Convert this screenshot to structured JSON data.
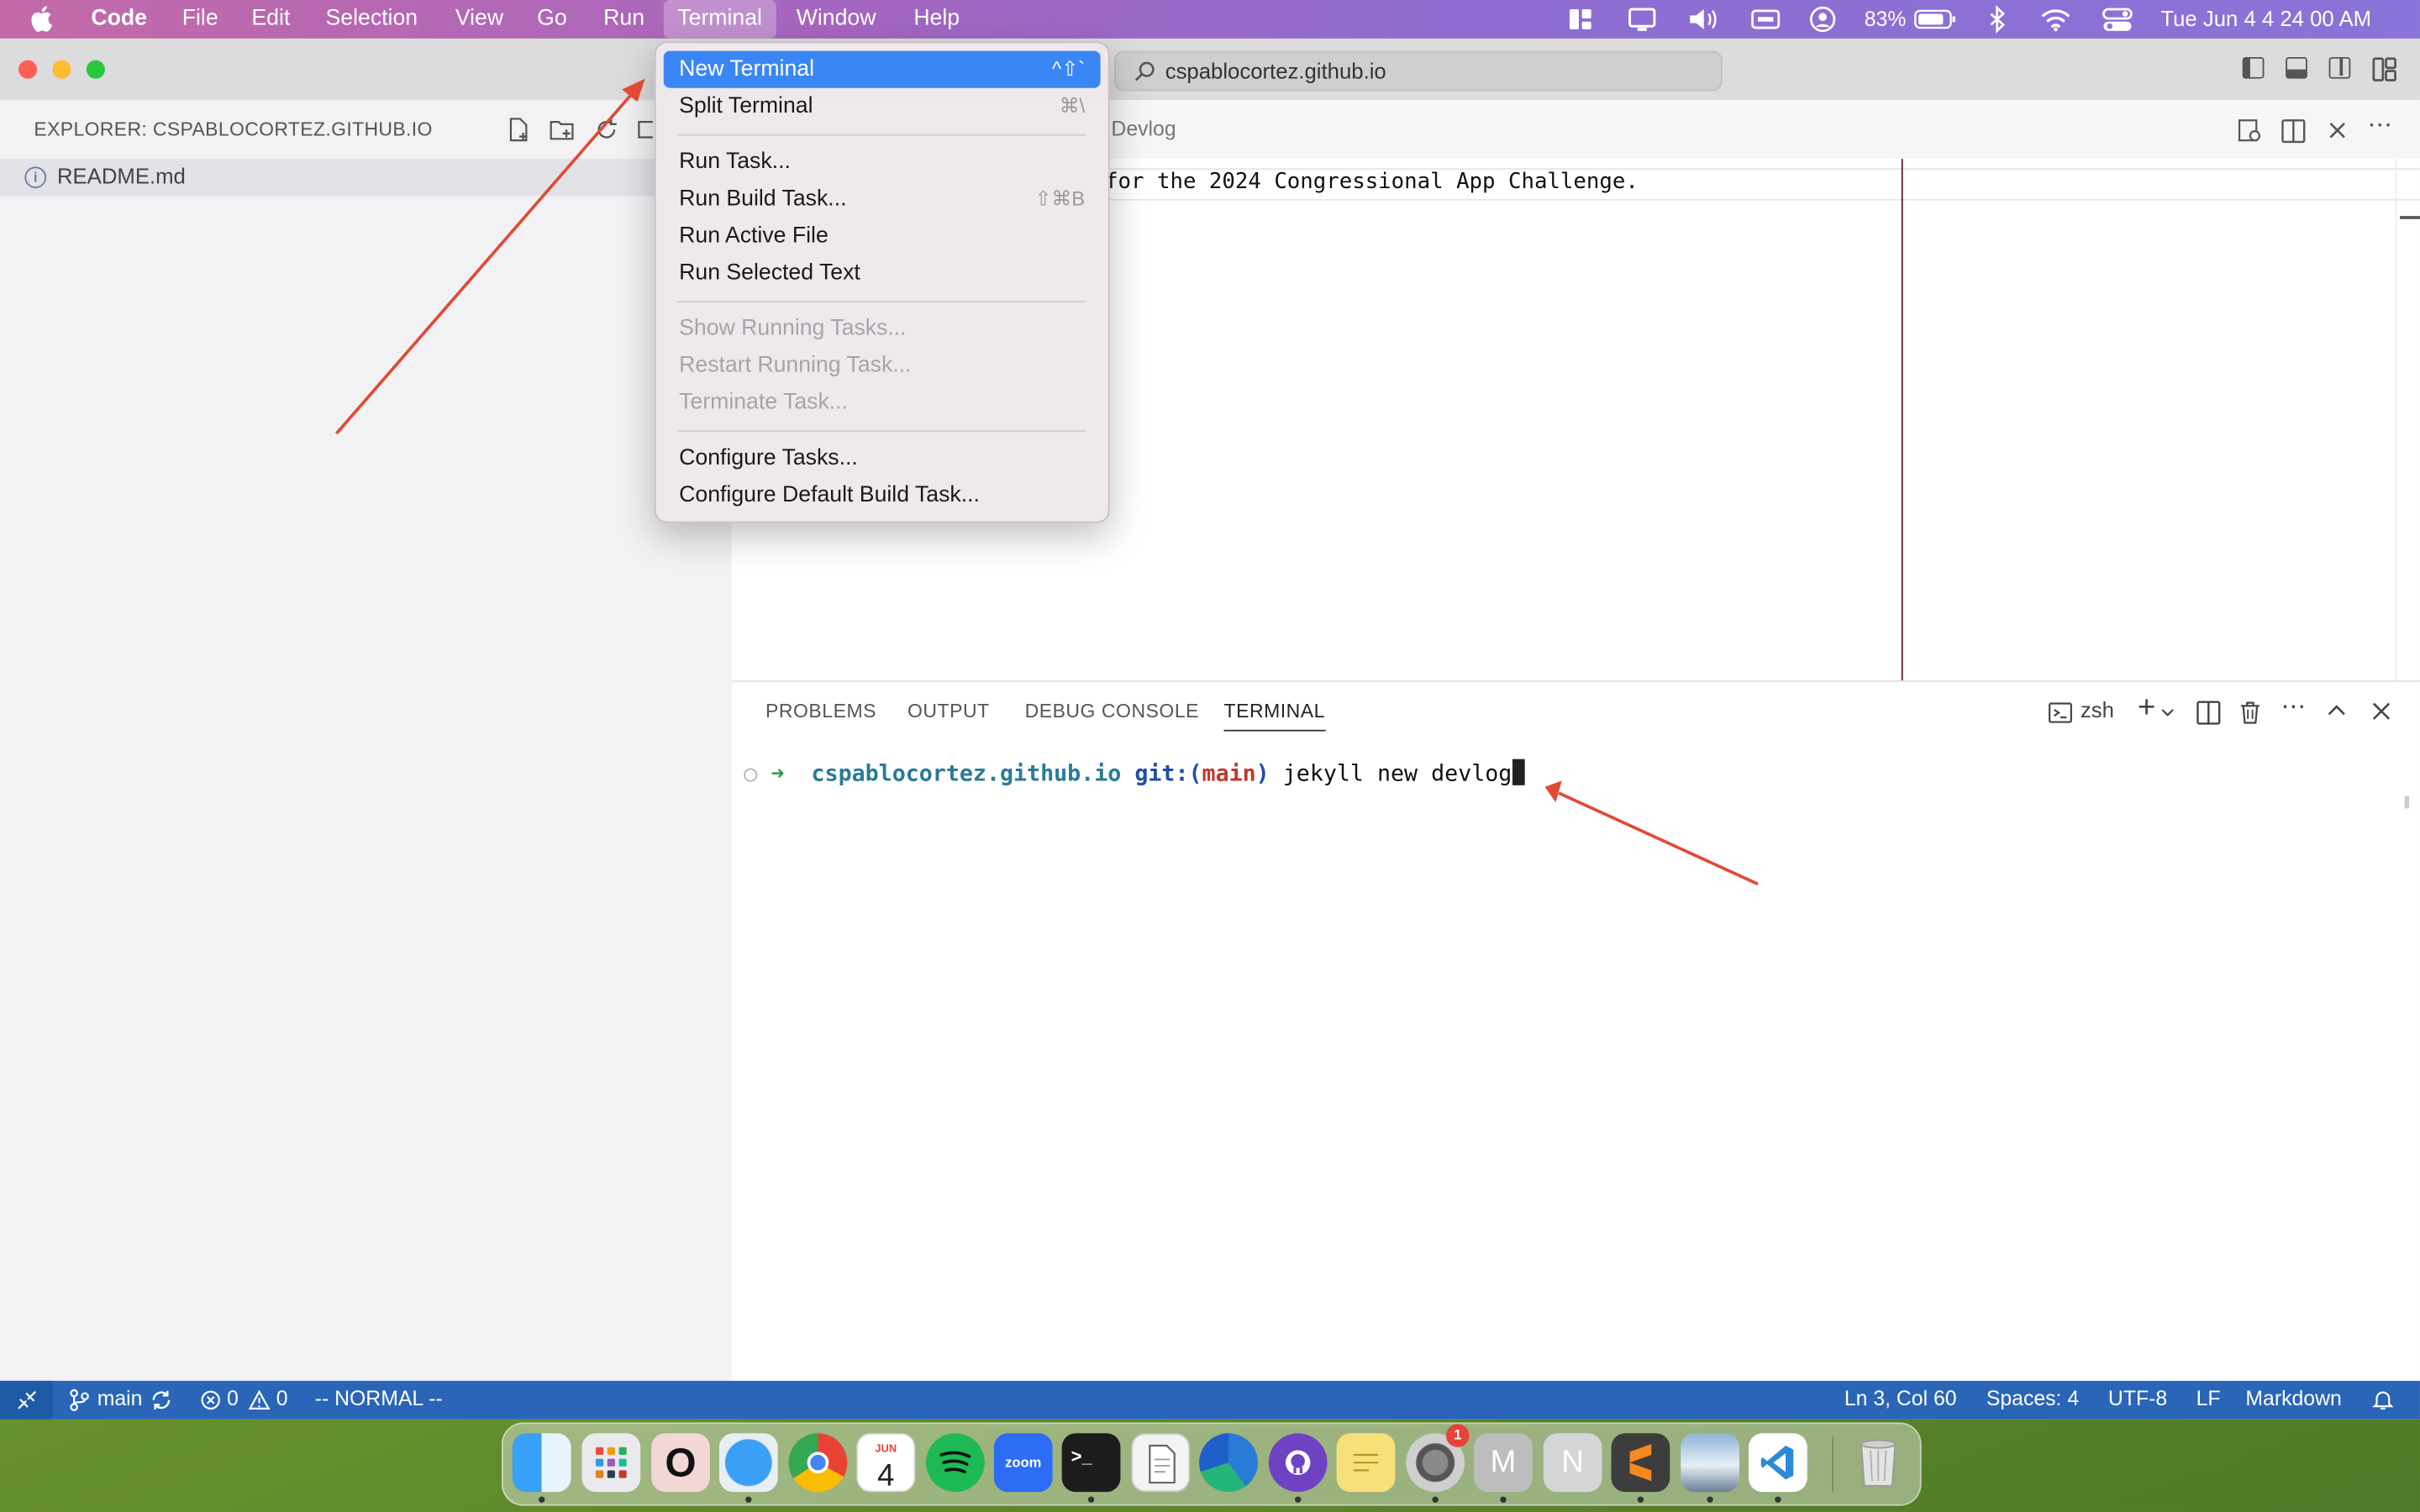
{
  "menubar": {
    "app": "Code",
    "items": [
      "File",
      "Edit",
      "Selection",
      "View",
      "Go",
      "Run",
      "Terminal",
      "Window",
      "Help"
    ],
    "battery": "83%",
    "datetime": "Tue Jun 4  4 24 00 AM"
  },
  "window": {
    "search_text": "cspablocortez.github.io"
  },
  "sidebar": {
    "title": "EXPLORER: CSPABLOCORTEZ.GITHUB.IO",
    "files": [
      "README.md"
    ]
  },
  "editor": {
    "tab_label": "Devlog",
    "code_line": "for the 2024 Congressional App Challenge."
  },
  "panel": {
    "tabs": [
      "PROBLEMS",
      "OUTPUT",
      "DEBUG CONSOLE",
      "TERMINAL"
    ],
    "shell": "zsh",
    "prompt_dir": "cspablocortez.github.io",
    "prompt_git": "git:(",
    "prompt_branch": "main",
    "prompt_close": ")",
    "command": "jekyll new devlog"
  },
  "terminal_menu": {
    "items": [
      {
        "label": "New Terminal",
        "shortcut": "^⇧`"
      },
      {
        "label": "Split Terminal",
        "shortcut": "⌘\\"
      },
      {
        "label": "Run Task..."
      },
      {
        "label": "Run Build Task...",
        "shortcut": "⇧⌘B"
      },
      {
        "label": "Run Active File"
      },
      {
        "label": "Run Selected Text"
      },
      {
        "label": "Show Running Tasks..."
      },
      {
        "label": "Restart Running Task..."
      },
      {
        "label": "Terminate Task..."
      },
      {
        "label": "Configure Tasks..."
      },
      {
        "label": "Configure Default Build Task..."
      }
    ]
  },
  "statusbar": {
    "branch": "main",
    "errors": "0",
    "warnings": "0",
    "mode": "-- NORMAL --",
    "position": "Ln 3, Col 60",
    "spaces": "Spaces: 4",
    "encoding": "UTF-8",
    "eol": "LF",
    "language": "Markdown"
  },
  "dock": {
    "calendar_month": "JUN",
    "calendar_day": "4",
    "zoom_label": "zoom",
    "settings_badge": "1",
    "m_letter": "M",
    "n_letter": "N"
  },
  "colors": {
    "accent": "#3a86f5",
    "statusbar": "#2a65b8",
    "annotation_arrow": "#e04a35"
  }
}
